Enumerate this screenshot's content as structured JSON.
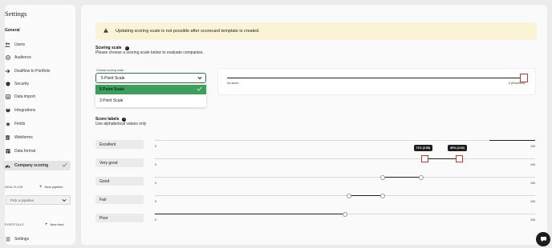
{
  "sidebar": {
    "title": "Settings",
    "section": "General",
    "items": [
      {
        "label": "Users",
        "icon": "users-icon"
      },
      {
        "label": "Audience",
        "icon": "audience-icon"
      },
      {
        "label": "Dealflow to Portfolio",
        "icon": "arrow-right-icon"
      },
      {
        "label": "Security",
        "icon": "shield-icon"
      },
      {
        "label": "Data import",
        "icon": "import-icon"
      },
      {
        "label": "Integrations",
        "icon": "plug-icon"
      },
      {
        "label": "Fields",
        "icon": "star-icon"
      },
      {
        "label": "Webforms",
        "icon": "document-icon"
      },
      {
        "label": "Data format",
        "icon": "format-icon"
      },
      {
        "label": "Company scoring",
        "icon": "gauge-icon",
        "active": true
      }
    ],
    "dealflow": {
      "label": "DEALFLOW",
      "add": "New pipeline",
      "placeholder": "Pick a pipeline"
    },
    "portfolio": {
      "label": "PORTFOLIO",
      "add": "New fund"
    },
    "footer": {
      "label": "Settings",
      "icon": "menu-icon"
    }
  },
  "banner": {
    "text": "Updating scoring scale is not possible after scorecard template is created."
  },
  "scoring_scale": {
    "title": "Scoring scale",
    "subtitle": "Please choose a scoring scale below to evaluate companies.",
    "choose_label": "Choose scoring scale",
    "selected": "5 Point Scale",
    "options": [
      "5 Point Scale",
      "3 Point Scale"
    ],
    "scale_min_label": "No score",
    "scale_max_label": "5 (Excellent)",
    "scale_value": 1.0
  },
  "score_labels": {
    "title": "Score labels",
    "subtitle": "Use alphabetical values only",
    "min_label": "0",
    "max_label": "100",
    "rows": [
      {
        "name": "Excellent",
        "range": [
          88,
          100
        ]
      },
      {
        "name": "Very good",
        "range": [
          71,
          80
        ],
        "low_tip": "71% (3.55)",
        "high_tip": "80% (4.00)"
      },
      {
        "name": "Good",
        "range": [
          60,
          70
        ]
      },
      {
        "name": "Fair",
        "range": [
          51,
          60
        ]
      },
      {
        "name": "Poor",
        "range": [
          0,
          50
        ]
      }
    ]
  },
  "colors": {
    "accent_green": "#3e9f5c",
    "handle_red": "#d9362b",
    "banner_bg": "#fbf3d6"
  }
}
